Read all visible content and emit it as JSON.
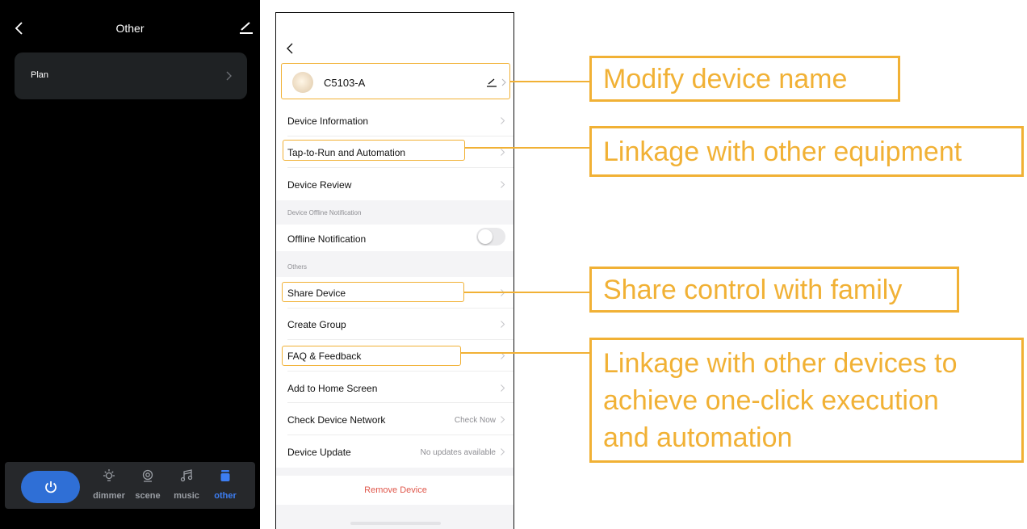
{
  "dark_screen": {
    "title": "Other",
    "plan_label": "Plan",
    "nav": [
      {
        "label": "dimmer",
        "icon": "lightbulb-icon"
      },
      {
        "label": "scene",
        "icon": "scene-icon"
      },
      {
        "label": "music",
        "icon": "music-icon"
      },
      {
        "label": "other",
        "icon": "other-icon"
      }
    ],
    "active_tab": "other",
    "accent_color": "#3d7ef2",
    "power_button_color": "#2f6fd6"
  },
  "settings_screen": {
    "device_name": "C5103-A",
    "rows": [
      {
        "label": "Device Information"
      },
      {
        "label": "Tap-to-Run and Automation"
      },
      {
        "label": "Device Review"
      }
    ],
    "offline_section_header": "Device Offline Notification",
    "offline_notification_label": "Offline Notification",
    "offline_notification_on": false,
    "others_section_header": "Others",
    "others_rows": [
      {
        "label": "Share Device",
        "value": ""
      },
      {
        "label": "Create Group",
        "value": ""
      },
      {
        "label": "FAQ & Feedback",
        "value": ""
      },
      {
        "label": "Add to Home Screen",
        "value": ""
      },
      {
        "label": "Check Device Network",
        "value": "Check Now"
      },
      {
        "label": "Device Update",
        "value": "No updates available"
      }
    ],
    "remove_label": "Remove Device",
    "remove_color": "#e0584c"
  },
  "annotations": {
    "modify_name": "Modify device name",
    "linkage_equipment": "Linkage with other equipment",
    "share_control": "Share control with family",
    "linkage_devices_lines": [
      "Linkage with other devices to",
      "achieve one-click execution",
      "and automation"
    ],
    "highlight_color": "#f1b135"
  }
}
